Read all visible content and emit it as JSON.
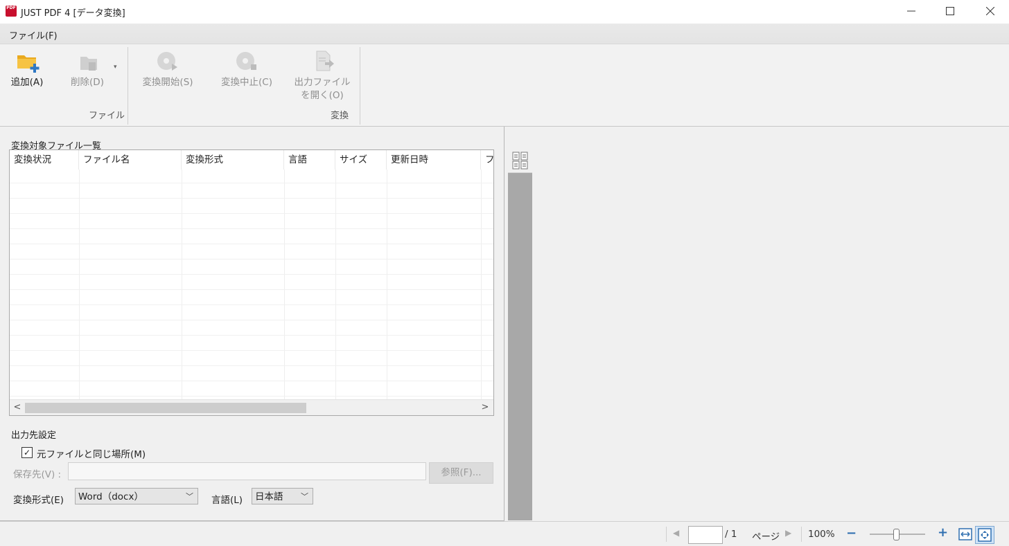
{
  "window": {
    "title": "JUST PDF 4 [データ変換]",
    "app_icon_text": "PDF",
    "minimize_icon": "minimize-icon",
    "maximize_icon": "maximize-icon",
    "close_icon": "close-icon"
  },
  "menu": {
    "file": "ファイル(F)"
  },
  "ribbon": {
    "add": "追加(A)",
    "delete": "削除(D)",
    "group_file": "ファイル",
    "start": "変換開始(S)",
    "stop": "変換中止(C)",
    "open_output_line1": "出力ファイル",
    "open_output_line2": "を開く(O)",
    "group_convert": "変換"
  },
  "file_list": {
    "title": "変換対象ファイル一覧",
    "columns": [
      "変換状況",
      "ファイル名",
      "変換形式",
      "言語",
      "サイズ",
      "更新日時",
      "フ"
    ]
  },
  "output": {
    "title": "出力先設定",
    "same_location_label": "元ファイルと同じ場所(M)",
    "same_location_checked": true,
    "save_to_label": "保存先(V) :",
    "save_to_value": "",
    "browse": "参照(F)...",
    "format_label": "変換形式(E)",
    "format_value": "Word（docx）",
    "language_label": "言語(L)",
    "language_value": "日本語"
  },
  "status": {
    "page_input": "",
    "page_total": "/  1",
    "page_unit": "ページ",
    "zoom": "100%",
    "zoom_minus": "−",
    "zoom_plus": "+",
    "zoom_slider_fraction": 0.48
  }
}
